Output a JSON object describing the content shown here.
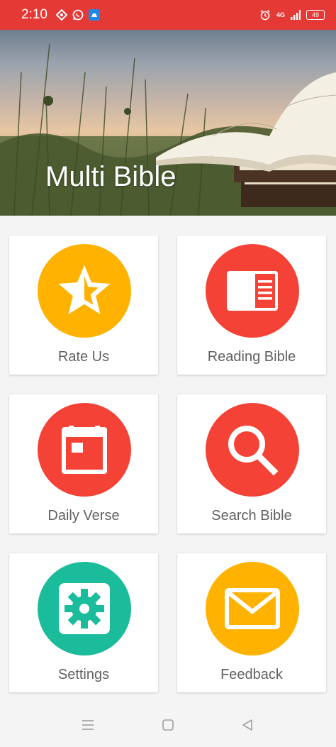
{
  "status_bar": {
    "time": "2:10",
    "network": "4G",
    "battery": "49",
    "color": "#e53935"
  },
  "header": {
    "title": "Multi Bible"
  },
  "menu": [
    {
      "label": "Rate Us",
      "icon": "star-icon",
      "color": "#ffb300"
    },
    {
      "label": "Reading Bible",
      "icon": "book-page-icon",
      "color": "#f44336"
    },
    {
      "label": "Daily Verse",
      "icon": "calendar-icon",
      "color": "#f44336"
    },
    {
      "label": "Search Bible",
      "icon": "search-icon",
      "color": "#f44336"
    },
    {
      "label": "Settings",
      "icon": "gear-icon",
      "color": "#1abc9c"
    },
    {
      "label": "Feedback",
      "icon": "mail-icon",
      "color": "#ffb300"
    }
  ],
  "nav_bar": {
    "icons": [
      "menu-icon",
      "home-icon",
      "back-icon"
    ]
  }
}
